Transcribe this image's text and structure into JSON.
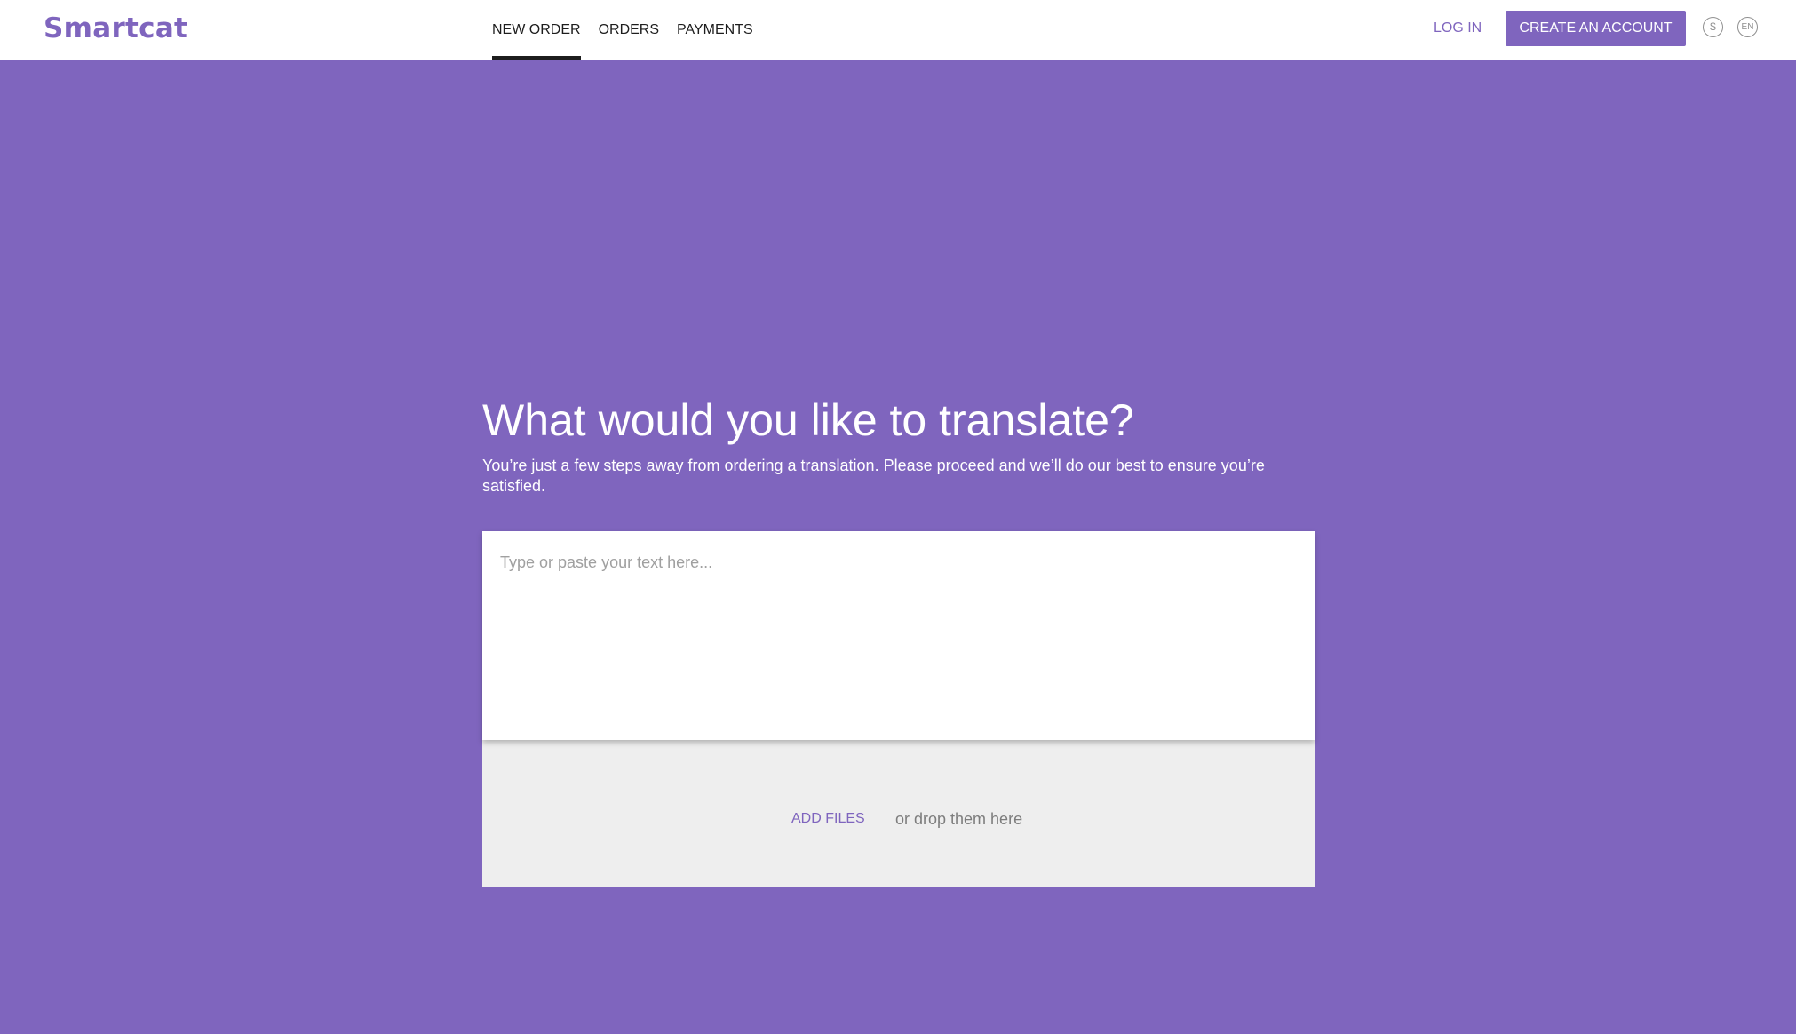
{
  "header": {
    "logo": "Smartcat",
    "nav": [
      {
        "label": "NEW ORDER",
        "active": true
      },
      {
        "label": "ORDERS",
        "active": false
      },
      {
        "label": "PAYMENTS",
        "active": false
      }
    ],
    "login_label": "LOG IN",
    "create_account_label": "CREATE AN ACCOUNT",
    "currency_symbol": "$",
    "language": "EN"
  },
  "main": {
    "title": "What would you like to translate?",
    "subtitle": "You’re just a few steps away from ordering a translation. Please proceed and we’ll do our best to ensure you’re satisfied.",
    "text_placeholder": "Type or paste your text here...",
    "text_value": "",
    "add_files_label": "ADD FILES",
    "drop_hint": "or drop them here"
  },
  "colors": {
    "accent": "#7f65be",
    "background": "#7f65be",
    "drop_zone": "#eeeeee"
  }
}
